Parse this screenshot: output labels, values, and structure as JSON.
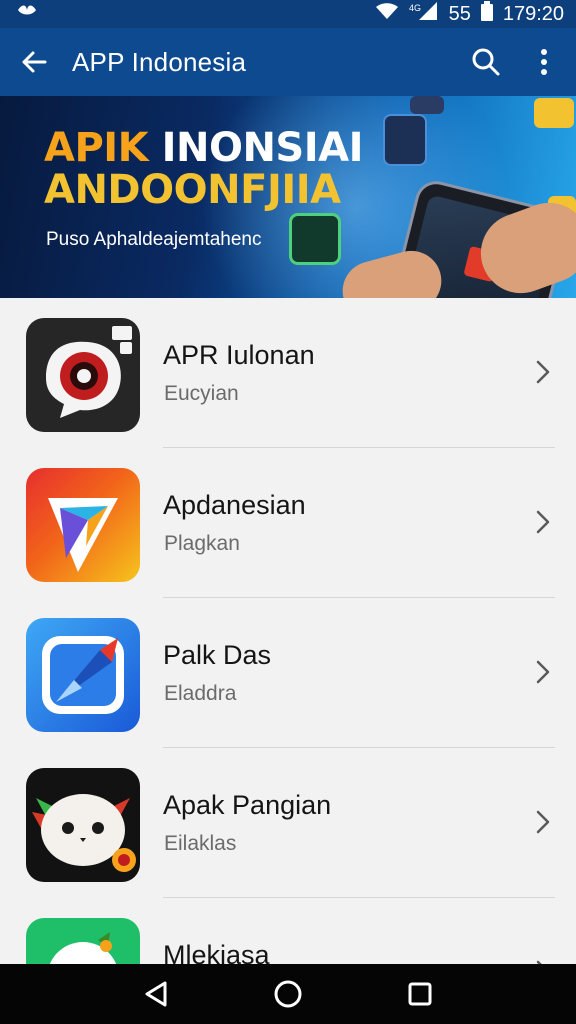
{
  "status_bar": {
    "battery_text": "55",
    "time": "179:20"
  },
  "app_bar": {
    "title": "APP Indonesia"
  },
  "banner": {
    "title_line1_a": "APIK",
    "title_line1_b": " INONSIAI",
    "title_line2": "ANDOONFJIIA",
    "subtitle": "Puso Aphaldeajemtahenc"
  },
  "apps": [
    {
      "title": "APR Iulonan",
      "subtitle": "Eucyian",
      "icon": "red-speaker-icon"
    },
    {
      "title": "Apdanesian",
      "subtitle": "Plagkan",
      "icon": "play-triangle-icon"
    },
    {
      "title": "Palk Das",
      "subtitle": "Eladdra",
      "icon": "blue-chat-icon"
    },
    {
      "title": "Apak Pangian",
      "subtitle": "Eilaklas",
      "icon": "mascot-face-icon"
    },
    {
      "title": "Mlekiasa",
      "subtitle": "",
      "icon": "green-circle-icon"
    }
  ],
  "colors": {
    "status_bar": "#0d3f7c",
    "app_bar": "#0e4a8f",
    "background": "#f2f2f2",
    "nav_bar": "#050505"
  }
}
